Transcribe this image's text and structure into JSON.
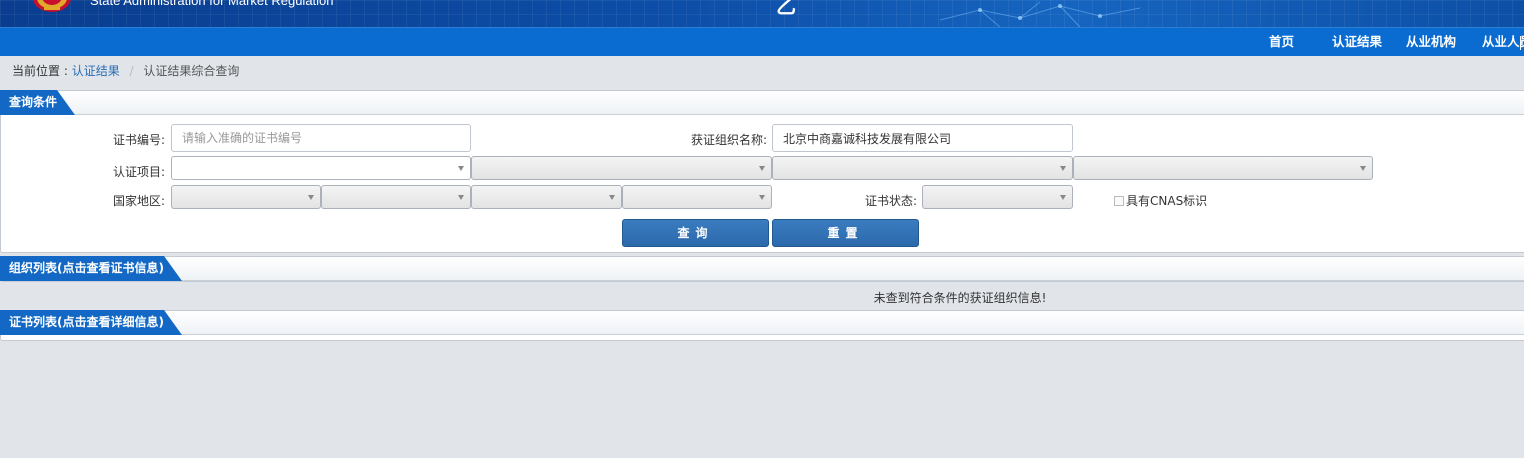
{
  "header": {
    "agency_name_en": "State Administration for Market Regulation",
    "title_glyph": "乙"
  },
  "nav": {
    "items": [
      "首页",
      "认证结果",
      "从业机构",
      "从业人员"
    ]
  },
  "breadcrumb": {
    "prefix": "当前位置 :",
    "link": "认证结果",
    "separator": "/",
    "current": "认证结果综合查询"
  },
  "query_panel": {
    "title": "查询条件",
    "cert_no_label": "证书编号:",
    "cert_no_placeholder": "请输入准确的证书编号",
    "org_name_label": "获证组织名称:",
    "org_name_value": "北京中商嘉诚科技发展有限公司",
    "project_label": "认证项目:",
    "region_label": "国家地区:",
    "status_label": "证书状态:",
    "cnas_label": "具有CNAS标识",
    "search_button": "查询",
    "reset_button": "重置"
  },
  "org_panel": {
    "title": "组织列表(点击查看证书信息)",
    "empty_message": "未查到符合条件的获证组织信息!"
  },
  "cert_panel": {
    "title": "证书列表(点击查看详细信息)"
  },
  "colors": {
    "banner": "#0d4ea8",
    "navbar": "#0a6bd1",
    "panel_tab": "#1268c4",
    "button": "#3171b6",
    "page_bg": "#e1e5ea"
  }
}
